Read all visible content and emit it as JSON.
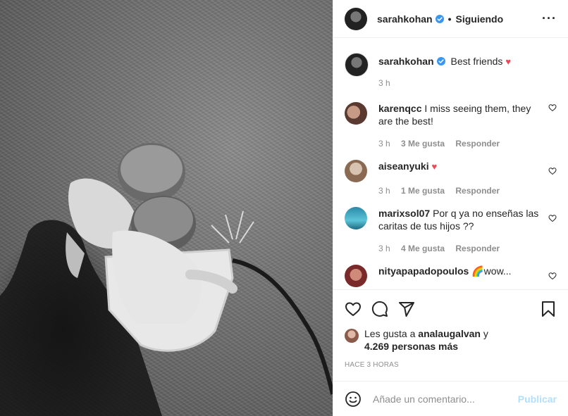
{
  "header": {
    "username": "sarahkohan",
    "separator": "•",
    "follow_status": "Siguiendo",
    "more_icon": "more-horizontal-icon"
  },
  "caption": {
    "username": "sarahkohan",
    "text": "Best friends",
    "time": "3 h"
  },
  "comments": [
    {
      "username": "karenqcc",
      "text": "I miss seeing them, they are the best!",
      "time": "3 h",
      "likes": "3 Me gusta",
      "reply": "Responder"
    },
    {
      "username": "aiseanyuki",
      "text": "",
      "time": "3 h",
      "likes": "1 Me gusta",
      "reply": "Responder"
    },
    {
      "username": "marixsol07",
      "text": "Por q ya no enseñas las caritas de tus hijos ??",
      "time": "3 h",
      "likes": "4 Me gusta",
      "reply": "Responder"
    },
    {
      "username": "nityapapadopoulos",
      "text": "🌈wow..."
    }
  ],
  "likes": {
    "prefix": "Les gusta a",
    "user": "analaugalvan",
    "joiner": "y",
    "count": "4.269 personas más"
  },
  "time_ago": "HACE 3 HORAS",
  "add_comment": {
    "placeholder": "Añade un comentario...",
    "post_label": "Publicar"
  },
  "colors": {
    "verified": "#3897f0",
    "heart_red": "#ed4956",
    "post_disabled": "#b2dffc"
  }
}
